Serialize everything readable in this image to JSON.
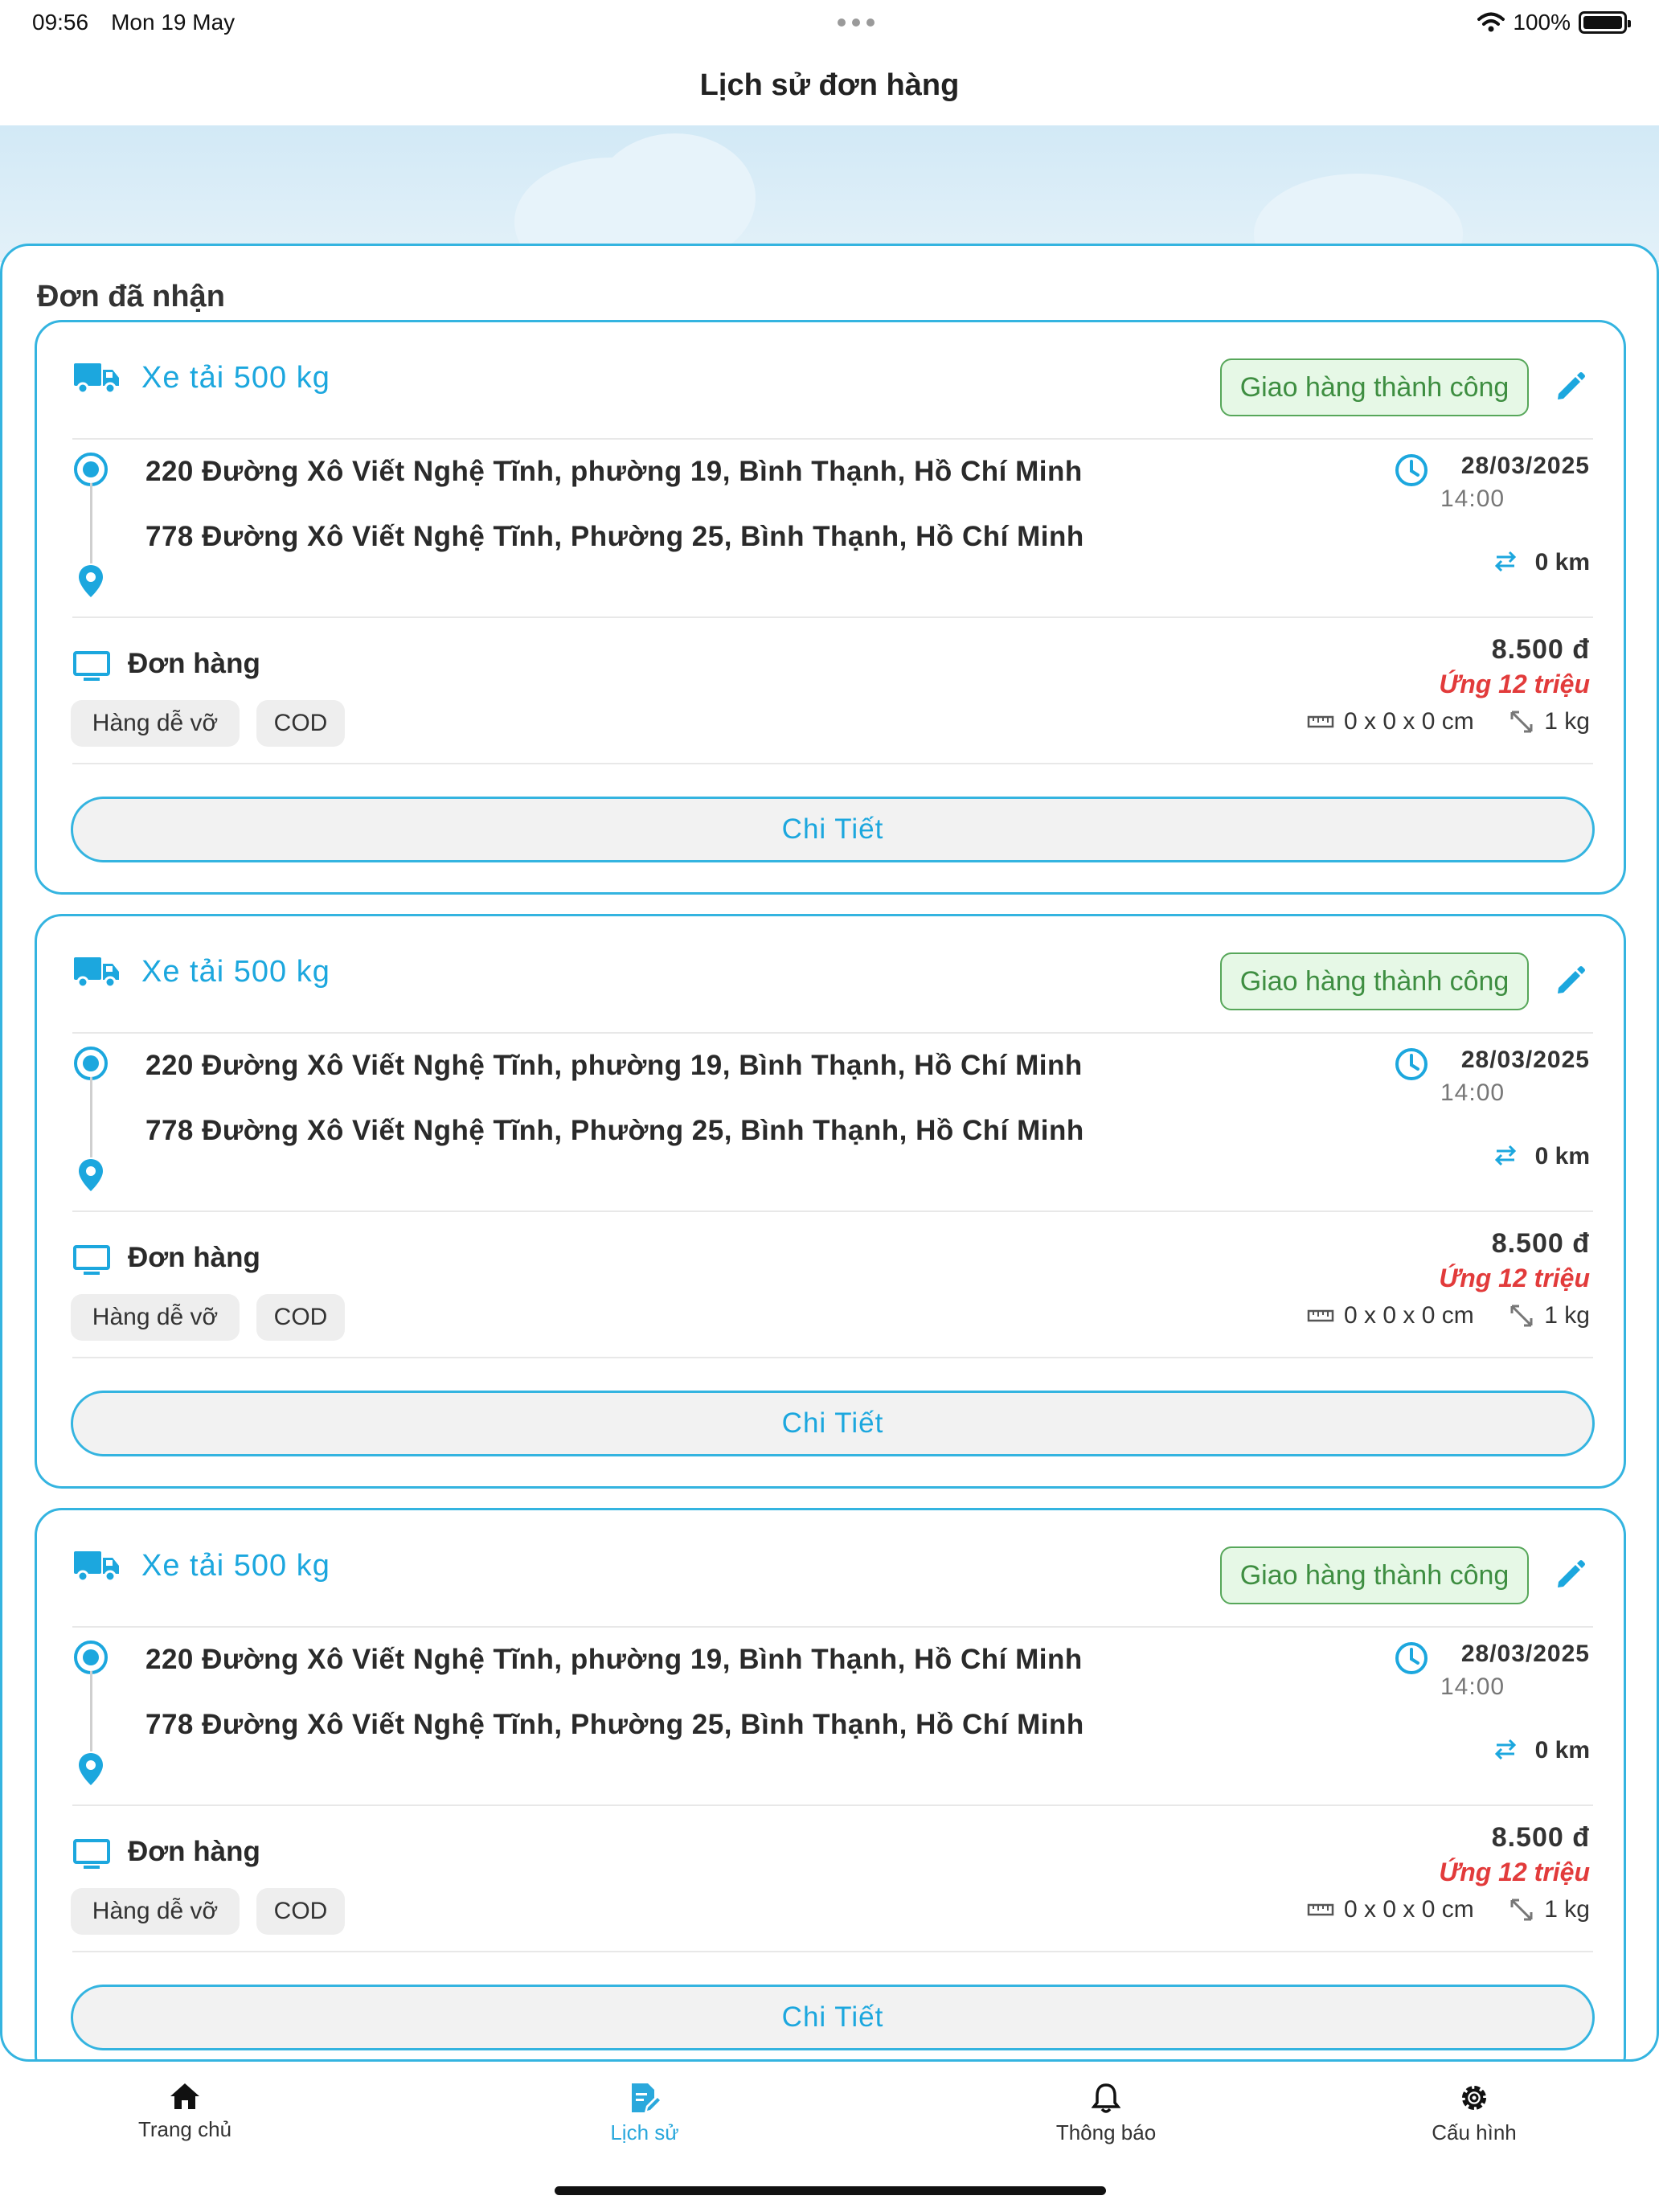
{
  "status_bar": {
    "time": "09:56",
    "date": "Mon 19 May",
    "battery": "100%"
  },
  "header": {
    "title": "Lịch sử đơn hàng"
  },
  "section": {
    "title": "Đơn đã nhận"
  },
  "colors": {
    "accent": "#1ca7de",
    "border": "#34b4e0",
    "success_bg": "#e6f8e6",
    "success_text": "#3e8e41",
    "danger": "#e23b3b"
  },
  "orders": [
    {
      "vehicle": "Xe tải 500 kg",
      "status": "Giao hàng thành công",
      "pickup": "220 Đường Xô Viết Nghệ Tĩnh, phường 19, Bình Thạnh, Hồ Chí Minh",
      "dropoff": "778 Đường Xô Viết Nghệ Tĩnh, Phường 25, Bình Thạnh, Hồ Chí Minh",
      "date": "28/03/2025",
      "time": "14:00",
      "distance": "0 km",
      "package_label": "Đơn hàng",
      "price": "8.500 đ",
      "advance": "Ứng 12 triệu",
      "tags": [
        "Hàng dễ vỡ",
        "COD"
      ],
      "dimensions": "0 x 0 x 0 cm",
      "weight": "1 kg",
      "detail_label": "Chi Tiết"
    },
    {
      "vehicle": "Xe tải 500 kg",
      "status": "Giao hàng thành công",
      "pickup": "220 Đường Xô Viết Nghệ Tĩnh, phường 19, Bình Thạnh, Hồ Chí Minh",
      "dropoff": "778 Đường Xô Viết Nghệ Tĩnh, Phường 25, Bình Thạnh, Hồ Chí Minh",
      "date": "28/03/2025",
      "time": "14:00",
      "distance": "0 km",
      "package_label": "Đơn hàng",
      "price": "8.500 đ",
      "advance": "Ứng 12 triệu",
      "tags": [
        "Hàng dễ vỡ",
        "COD"
      ],
      "dimensions": "0 x 0 x 0 cm",
      "weight": "1 kg",
      "detail_label": "Chi Tiết"
    },
    {
      "vehicle": "Xe tải 500 kg",
      "status": "Giao hàng thành công",
      "pickup": "220 Đường Xô Viết Nghệ Tĩnh, phường 19, Bình Thạnh, Hồ Chí Minh",
      "dropoff": "778 Đường Xô Viết Nghệ Tĩnh, Phường 25, Bình Thạnh, Hồ Chí Minh",
      "date": "28/03/2025",
      "time": "14:00",
      "distance": "0 km",
      "package_label": "Đơn hàng",
      "price": "8.500 đ",
      "advance": "Ứng 12 triệu",
      "tags": [
        "Hàng dễ vỡ",
        "COD"
      ],
      "dimensions": "0 x 0 x 0 cm",
      "weight": "1 kg",
      "detail_label": "Chi Tiết"
    }
  ],
  "nav": [
    {
      "label": "Trang chủ",
      "icon": "home-icon",
      "active": false
    },
    {
      "label": "Lịch sử",
      "icon": "history-edit-icon",
      "active": true
    },
    {
      "label": "Thông báo",
      "icon": "bell-icon",
      "active": false
    },
    {
      "label": "Cấu hình",
      "icon": "gear-icon",
      "active": false
    }
  ]
}
